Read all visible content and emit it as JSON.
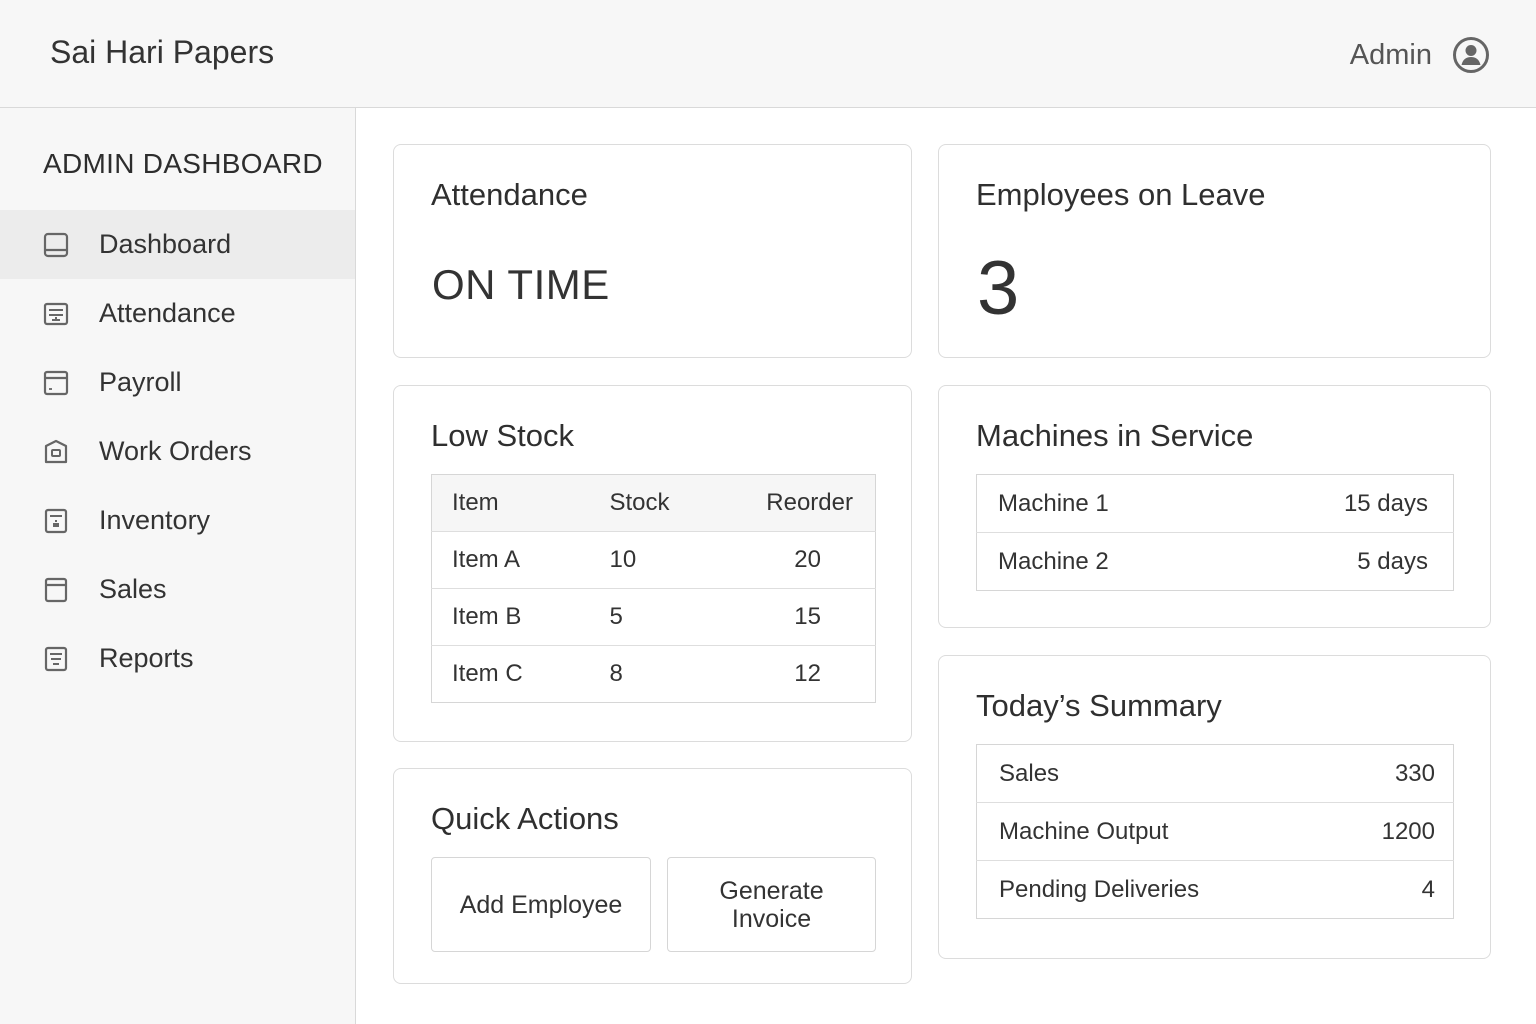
{
  "header": {
    "app_title": "Sai Hari Papers",
    "user_name": "Admin"
  },
  "sidebar": {
    "title": "ADMIN DASHBOARD",
    "items": [
      {
        "label": "Dashboard",
        "icon": "dashboard-icon",
        "active": true
      },
      {
        "label": "Attendance",
        "icon": "attendance-icon",
        "active": false
      },
      {
        "label": "Payroll",
        "icon": "payroll-icon",
        "active": false
      },
      {
        "label": "Work Orders",
        "icon": "work-orders-icon",
        "active": false
      },
      {
        "label": "Inventory",
        "icon": "inventory-icon",
        "active": false
      },
      {
        "label": "Sales",
        "icon": "sales-icon",
        "active": false
      },
      {
        "label": "Reports",
        "icon": "reports-icon",
        "active": false
      }
    ]
  },
  "attendance_card": {
    "title": "Attendance",
    "status": "ON TIME"
  },
  "leave_card": {
    "title": "Employees on Leave",
    "count": "3"
  },
  "low_stock": {
    "title": "Low Stock",
    "columns": [
      "Item",
      "Stock",
      "Reorder"
    ],
    "rows": [
      {
        "item": "Item A",
        "stock": "10",
        "reorder": "20"
      },
      {
        "item": "Item B",
        "stock": "5",
        "reorder": "15"
      },
      {
        "item": "Item C",
        "stock": "8",
        "reorder": "12"
      }
    ]
  },
  "machines": {
    "title": "Machines in Service",
    "rows": [
      {
        "name": "Machine 1",
        "duration": "15 days"
      },
      {
        "name": "Machine 2",
        "duration": "5 days"
      }
    ]
  },
  "quick_actions": {
    "title": "Quick Actions",
    "add_employee": "Add Employee",
    "generate_invoice_line1": "Generate",
    "generate_invoice_line2": "Invoice"
  },
  "summary": {
    "title": "Today’s Summary",
    "rows": [
      {
        "label": "Sales",
        "value": "330"
      },
      {
        "label": "Machine Output",
        "value": "1200"
      },
      {
        "label": "Pending Deliveries",
        "value": "4"
      }
    ]
  },
  "colors": {
    "background": "#ffffff",
    "chrome": "#f7f7f7",
    "border": "#dcdcdc",
    "active_nav": "#ececec",
    "text": "#2f2f2f",
    "icon": "#666666"
  }
}
